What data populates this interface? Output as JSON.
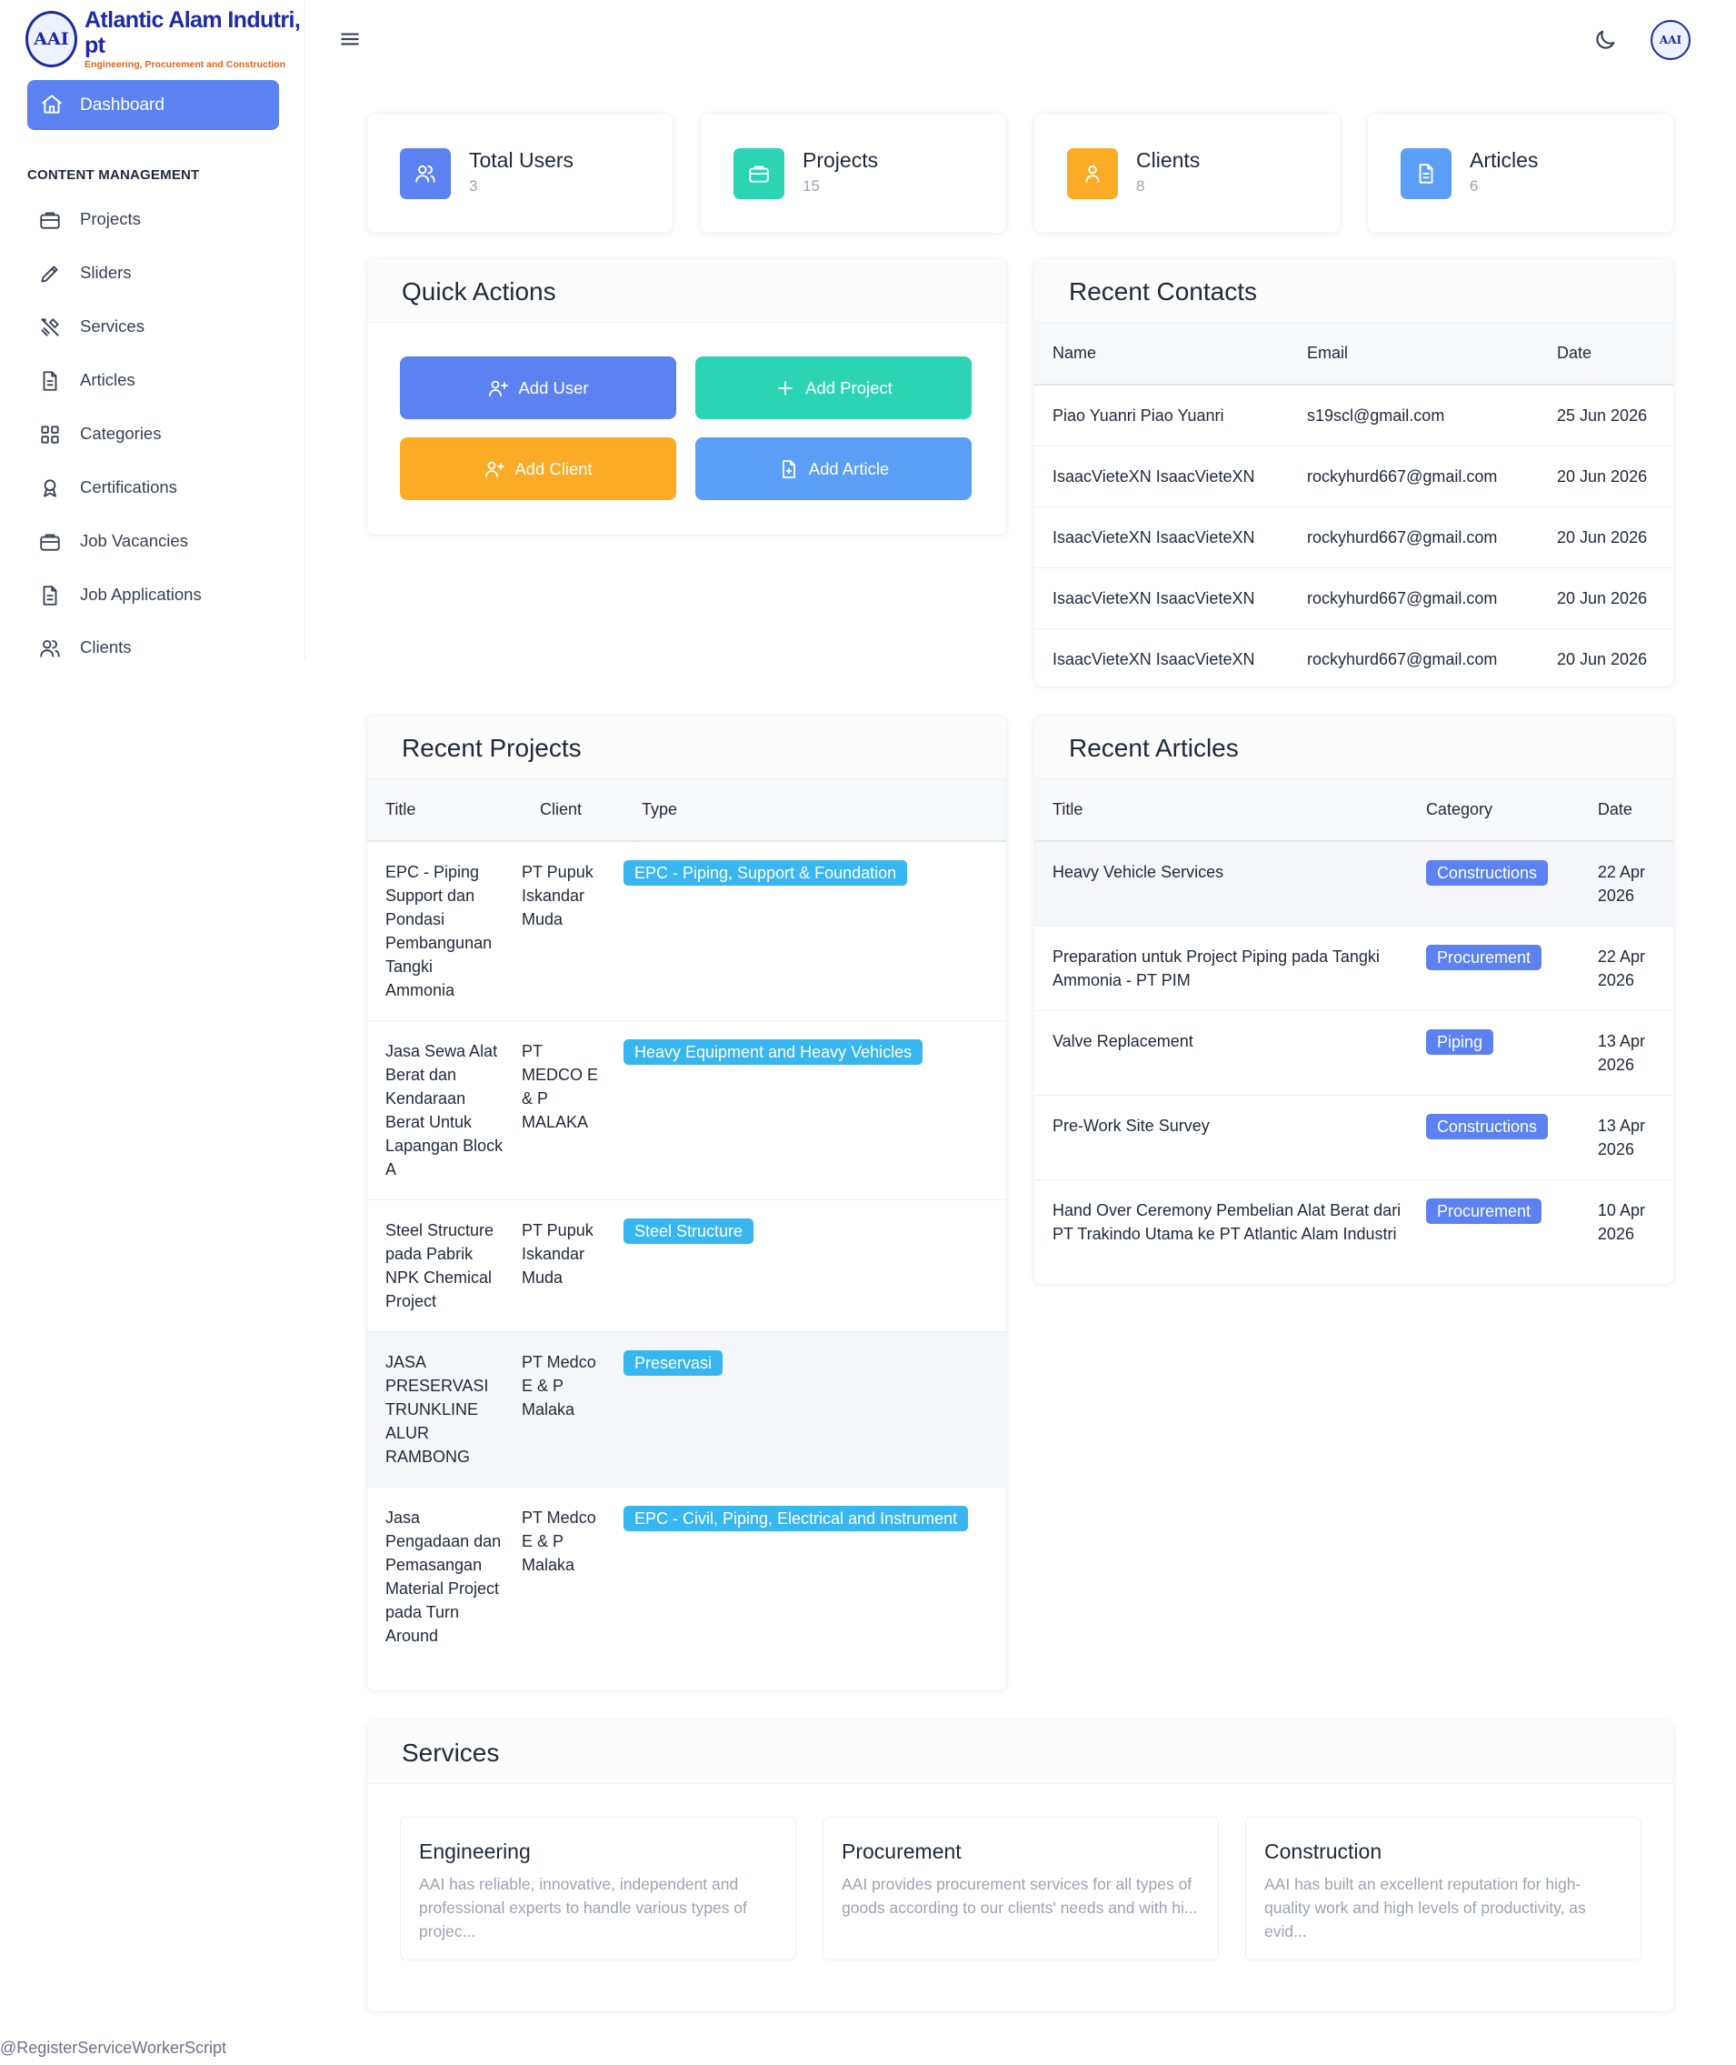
{
  "brand": {
    "name": "Atlantic Alam Indutri, pt",
    "tagline": "Engineering, Procurement and Construction",
    "logo_text": "AAI"
  },
  "sidebar": {
    "dashboard_label": "Dashboard",
    "section_title": "CONTENT MANAGEMENT",
    "items": [
      {
        "label": "Projects",
        "icon": "briefcase-icon"
      },
      {
        "label": "Sliders",
        "icon": "pencil-icon"
      },
      {
        "label": "Services",
        "icon": "tools-icon"
      },
      {
        "label": "Articles",
        "icon": "document-icon"
      },
      {
        "label": "Categories",
        "icon": "grid-icon"
      },
      {
        "label": "Certifications",
        "icon": "award-icon"
      },
      {
        "label": "Job Vacancies",
        "icon": "briefcase-icon"
      },
      {
        "label": "Job Applications",
        "icon": "document-icon"
      },
      {
        "label": "Clients",
        "icon": "users-icon"
      }
    ]
  },
  "topbar": {
    "menu_icon": "hamburger-icon",
    "theme_icon": "moon-icon",
    "avatar_text": "AAI"
  },
  "stats": [
    {
      "label": "Total Users",
      "value": "3",
      "color": "#5b82f0",
      "icon": "users-icon"
    },
    {
      "label": "Projects",
      "value": "15",
      "color": "#2ad4b4",
      "icon": "briefcase-icon"
    },
    {
      "label": "Clients",
      "value": "8",
      "color": "#fbab25",
      "icon": "user-icon"
    },
    {
      "label": "Articles",
      "value": "6",
      "color": "#5b9ef5",
      "icon": "document-icon"
    }
  ],
  "quick_actions": {
    "title": "Quick Actions",
    "buttons": [
      {
        "label": "Add User",
        "color": "#5b82f0",
        "icon": "user-plus-icon"
      },
      {
        "label": "Add Project",
        "color": "#2ad4b4",
        "icon": "plus-icon"
      },
      {
        "label": "Add Client",
        "color": "#fbab25",
        "icon": "user-plus-icon"
      },
      {
        "label": "Add Article",
        "color": "#5b9ef5",
        "icon": "file-plus-icon"
      }
    ]
  },
  "recent_contacts": {
    "title": "Recent Contacts",
    "columns": [
      "Name",
      "Email",
      "Date"
    ],
    "rows": [
      [
        "Piao Yuanri Piao Yuanri",
        "s19scl@gmail.com",
        "25 Jun 2026"
      ],
      [
        "IsaacVieteXN IsaacVieteXN",
        "rockyhurd667@gmail.com",
        "20 Jun 2026"
      ],
      [
        "IsaacVieteXN IsaacVieteXN",
        "rockyhurd667@gmail.com",
        "20 Jun 2026"
      ],
      [
        "IsaacVieteXN IsaacVieteXN",
        "rockyhurd667@gmail.com",
        "20 Jun 2026"
      ],
      [
        "IsaacVieteXN IsaacVieteXN",
        "rockyhurd667@gmail.com",
        "20 Jun 2026"
      ]
    ]
  },
  "recent_projects": {
    "title": "Recent Projects",
    "columns": [
      "Title",
      "Client",
      "Type"
    ],
    "rows": [
      [
        "EPC - Piping Support dan Pondasi Pembangunan Tangki Ammonia",
        "PT Pupuk Iskandar Muda",
        "EPC - Piping, Support & Foundation"
      ],
      [
        "Jasa Sewa Alat Berat dan Kendaraan Berat Untuk Lapangan Block A",
        "PT MEDCO E & P MALAKA",
        "Heavy Equipment and Heavy Vehicles"
      ],
      [
        "Steel Structure pada Pabrik NPK Chemical Project",
        "PT Pupuk Iskandar Muda",
        "Steel Structure"
      ],
      [
        "JASA PRESERVASI TRUNKLINE ALUR RAMBONG",
        "PT Medco E & P Malaka",
        "Preservasi"
      ],
      [
        "Jasa Pengadaan dan Pemasangan Material Project pada Turn Around",
        "PT Medco E & P Malaka",
        "EPC - Civil, Piping, Electrical and Instrument"
      ]
    ]
  },
  "recent_articles": {
    "title": "Recent Articles",
    "columns": [
      "Title",
      "Category",
      "Date"
    ],
    "rows": [
      [
        "Heavy Vehicle Services",
        "Constructions",
        "22 Apr 2026"
      ],
      [
        "Preparation untuk Project Piping pada Tangki Ammonia - PT PIM",
        "Procurement",
        "22 Apr 2026"
      ],
      [
        "Valve Replacement",
        "Piping",
        "13 Apr 2026"
      ],
      [
        "Pre-Work Site Survey",
        "Constructions",
        "13 Apr 2026"
      ],
      [
        "Hand Over Ceremony Pembelian Alat Berat dari PT Trakindo Utama ke PT Atlantic Alam Industri",
        "Procurement",
        "10 Apr 2026"
      ]
    ]
  },
  "services": {
    "title": "Services",
    "items": [
      {
        "title": "Engineering",
        "desc": "AAI has reliable, innovative, independent and professional experts to handle various types of projec..."
      },
      {
        "title": "Procurement",
        "desc": "AAI provides procurement services for all types of goods according to our clients' needs and with hi..."
      },
      {
        "title": "Construction",
        "desc": "AAI has built an excellent reputation for high-quality work and high levels of productivity, as evid..."
      }
    ]
  },
  "footer_text": "@RegisterServiceWorkerScript"
}
